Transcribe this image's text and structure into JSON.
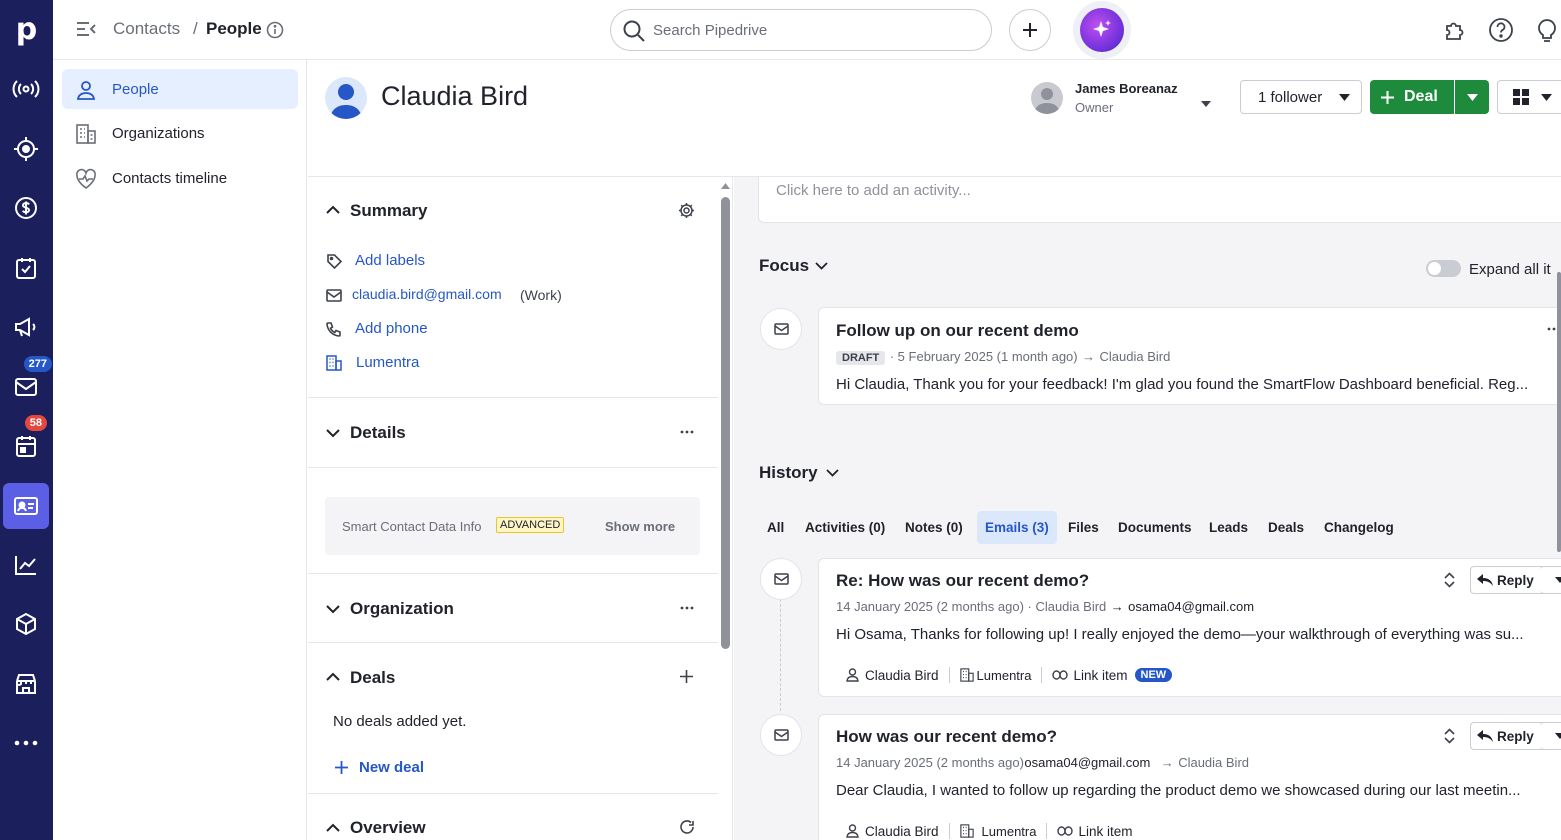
{
  "app": {
    "name": "Pipedrive",
    "logo_letter": "p"
  },
  "rail": {
    "items": [
      {
        "name": "activity-icon"
      },
      {
        "name": "target-icon"
      },
      {
        "name": "dollar-icon"
      },
      {
        "name": "tasks-icon"
      },
      {
        "name": "campaigns-icon"
      },
      {
        "name": "mail-icon",
        "badge": "277"
      },
      {
        "name": "calendar-icon",
        "badge": "58"
      },
      {
        "name": "contacts-icon",
        "active": true
      },
      {
        "name": "insights-icon"
      },
      {
        "name": "products-icon"
      },
      {
        "name": "marketplace-icon"
      },
      {
        "name": "more-icon"
      }
    ],
    "badge_blue": "#2657c7",
    "badge_red": "#e5483e"
  },
  "topbar": {
    "breadcrumb_parent": "Contacts",
    "breadcrumb_sep": "/",
    "breadcrumb_current": "People",
    "search_placeholder": "Search Pipedrive"
  },
  "subnav": {
    "items": [
      "People",
      "Organizations",
      "Contacts timeline"
    ]
  },
  "person": {
    "name": "Claudia Bird",
    "owner_name": "James Boreanaz",
    "owner_role": "Owner",
    "follower_label": "1 follower",
    "deal_label": "Deal"
  },
  "summary": {
    "title": "Summary",
    "add_labels": "Add labels",
    "email": "claudia.bird@gmail.com",
    "email_type": "(Work)",
    "add_phone": "Add phone",
    "organization": "Lumentra"
  },
  "details": {
    "title": "Details",
    "smart_label": "Smart Contact Data Info",
    "smart_badge": "ADVANCED",
    "show_more": "Show more"
  },
  "organization_section": {
    "title": "Organization"
  },
  "deals_section": {
    "title": "Deals",
    "empty": "No deals added yet.",
    "new_deal": "New deal"
  },
  "overview_section": {
    "title": "Overview"
  },
  "activity": {
    "placeholder": "Click here to add an activity..."
  },
  "focus": {
    "title": "Focus",
    "expand_label": "Expand all it",
    "item": {
      "subject": "Follow up on our recent demo",
      "status": "DRAFT",
      "meta": "· 5 February 2025 (1 month ago)",
      "to": "Claudia Bird",
      "preview": "Hi Claudia, Thank you for your feedback! I'm glad you found the SmartFlow Dashboard beneficial. Reg..."
    }
  },
  "history": {
    "title": "History",
    "tabs": [
      "All",
      "Activities (0)",
      "Notes (0)",
      "Emails (3)",
      "Files",
      "Documents",
      "Leads",
      "Deals",
      "Changelog"
    ],
    "active_tab": "Emails (3)",
    "emails": [
      {
        "subject": "Re: How was our recent demo?",
        "meta": "14 January 2025 (2 months ago) · Claudia Bird",
        "to": "osama04@gmail.com",
        "preview": "Hi Osama, Thanks for following up! I really enjoyed the demo—your walkthrough of everything was su...",
        "person_chip": "Claudia Bird",
        "org_chip": "Lumentra",
        "link_chip": "Link item",
        "new_badge": "NEW",
        "reply_label": "Reply"
      },
      {
        "subject": "How was our recent demo?",
        "meta": "14 January 2025 (2 months ago)",
        "from": "osama04@gmail.com",
        "to": "Claudia Bird",
        "preview": "Dear Claudia, I wanted to follow up regarding the product demo we showcased during our last meetin...",
        "person_chip": "Claudia Bird",
        "org_chip": "Lumentra",
        "link_chip": "Link item",
        "reply_label": "Reply"
      }
    ]
  },
  "colors": {
    "rail": "#1b1f5b",
    "accent": "#2657c7",
    "deal_green": "#1e8a3c",
    "ai_purple": "#7b3fe4"
  }
}
